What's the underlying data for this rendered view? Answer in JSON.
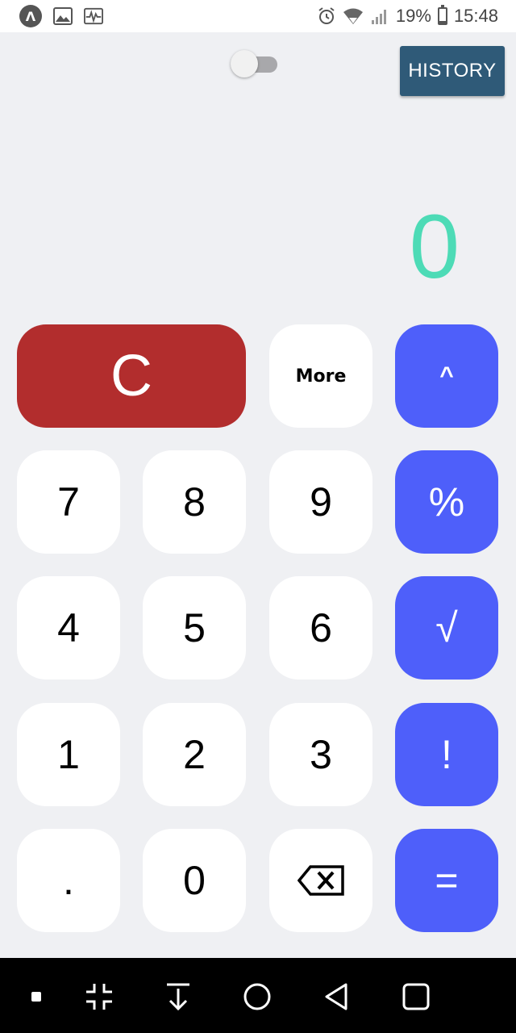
{
  "status_bar": {
    "app_badge": "Λ",
    "battery_percent": "19%",
    "time": "15:48",
    "battery_level": 0.19
  },
  "toggle": {
    "on": false
  },
  "history_button": {
    "label": "HISTORY"
  },
  "display": {
    "value": "0"
  },
  "keys": {
    "clear": "C",
    "more": "More",
    "power": "^",
    "seven": "7",
    "eight": "8",
    "nine": "9",
    "percent": "%",
    "four": "4",
    "five": "5",
    "six": "6",
    "sqrt": "√",
    "one": "1",
    "two": "2",
    "three": "3",
    "factorial": "!",
    "dot": ".",
    "zero": "0",
    "equals": "="
  },
  "colors": {
    "clear_key": "#b22d2d",
    "operator_key": "#4e5ffa",
    "display_text": "#4ddbb6",
    "history_button": "#2f5a78",
    "background": "#eff0f3"
  },
  "nav_icons": [
    "square-dot-icon",
    "shrink-icon",
    "download-icon",
    "home-circle-icon",
    "back-triangle-icon",
    "recents-square-icon"
  ]
}
